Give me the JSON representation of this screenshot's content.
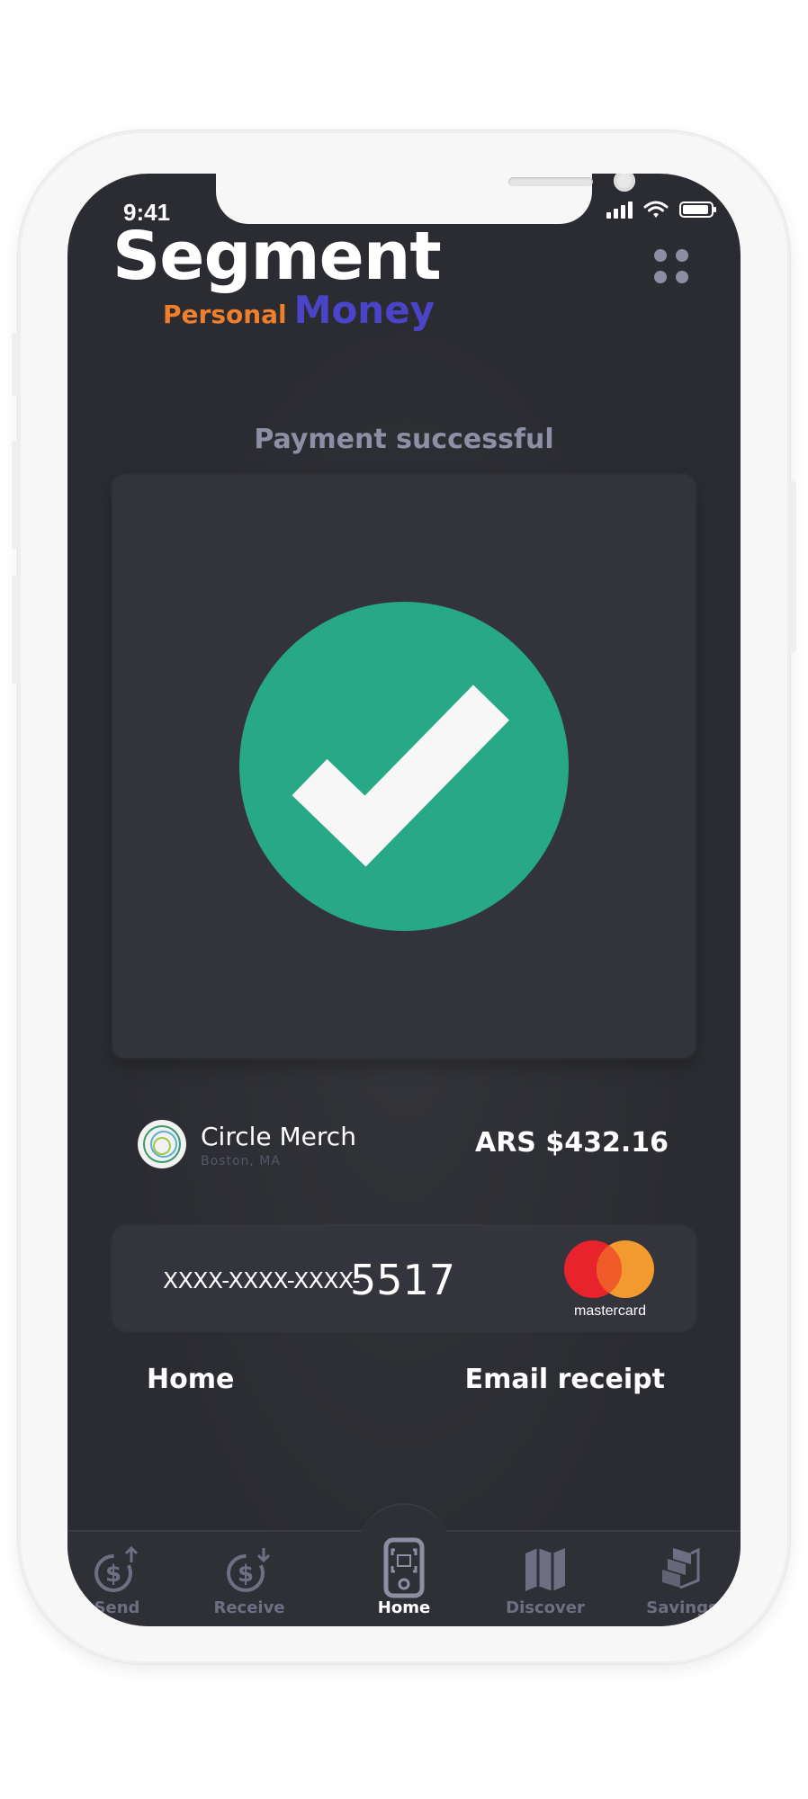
{
  "status_bar": {
    "time": "9:41"
  },
  "brand": {
    "name": "Segment",
    "sub_personal": "Personal",
    "sub_money": "Money"
  },
  "headline": "Payment successful",
  "merchant": {
    "name": "Circle Merch",
    "location": "Boston, MA",
    "amount": "ARS $432.16"
  },
  "card": {
    "prefix": "XXXX-XXXX-XXXX-",
    "last4": "5517",
    "network": "mastercard"
  },
  "actions": {
    "home": "Home",
    "email_receipt": "Email receipt"
  },
  "tabs": [
    {
      "label": "Send",
      "icon": "send-money-icon"
    },
    {
      "label": "Receive",
      "icon": "receive-money-icon"
    },
    {
      "label": "Home",
      "icon": "scan-phone-icon",
      "active": true
    },
    {
      "label": "Discover",
      "icon": "map-icon"
    },
    {
      "label": "Savings",
      "icon": "stack-icon"
    }
  ],
  "colors": {
    "screen_bg": "#2b2c31",
    "success": "#27a886",
    "brand_orange": "#f07f2c",
    "brand_blue": "#4a45c8",
    "muted": "#8e8fa5"
  }
}
